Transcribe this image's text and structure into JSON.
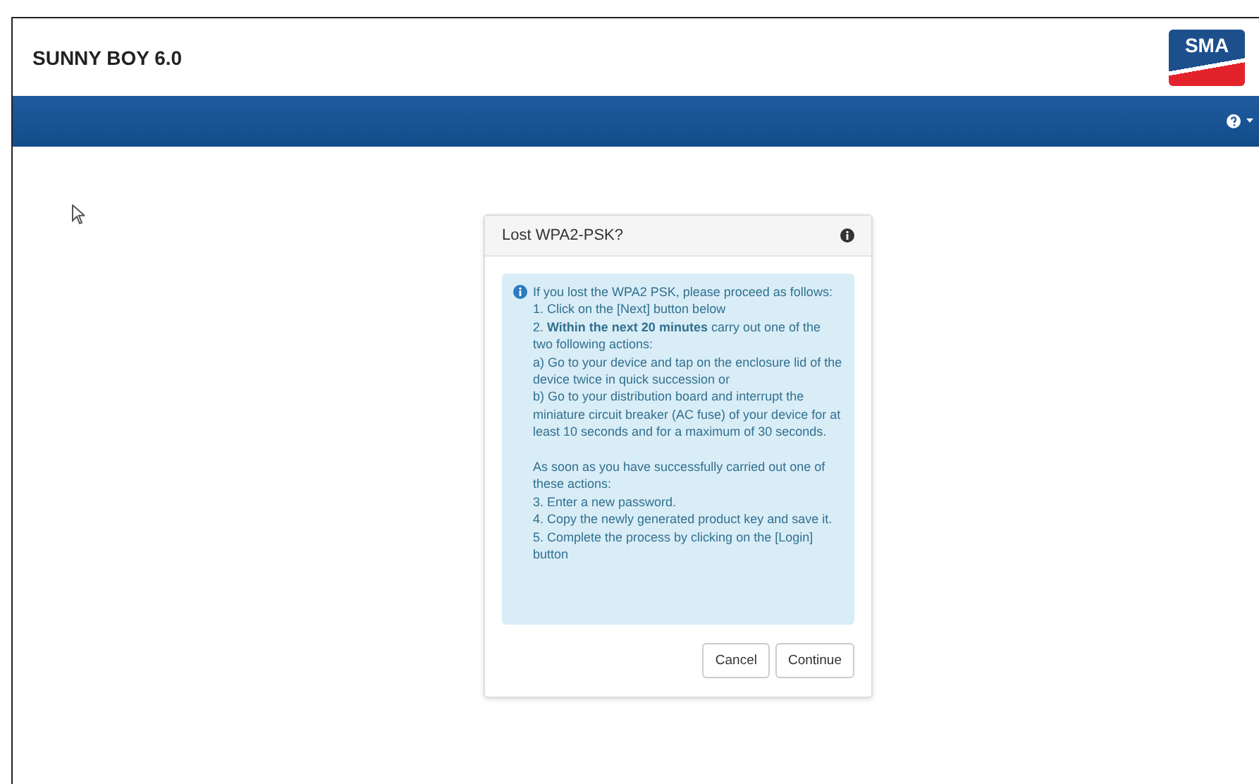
{
  "header": {
    "title": "SUNNY BOY 6.0",
    "logo": "SMA"
  },
  "dialog": {
    "title": "Lost WPA2-PSK?",
    "message": {
      "intro": "If you lost the WPA2 PSK, please proceed as follows:",
      "paragraphs": [
        [
          "1. Click on the [Next] button below",
          "2. **Within the next 20 minutes** carry out one of the two following actions:",
          "a) Go to your device and tap on the enclosure lid of the device twice in quick succession or",
          "b) Go to your distribution board and interrupt the miniature circuit breaker (AC fuse) of your device for at least 10 seconds and for a maximum of 30 seconds."
        ],
        [
          "As soon as you have successfully carried out one of these actions:",
          "3. Enter a new password.",
          "4. Copy the newly generated product key and save it.",
          "5. Complete the process by clicking on the [Login] button"
        ]
      ]
    },
    "buttons": [
      "Cancel",
      "Continue"
    ]
  }
}
